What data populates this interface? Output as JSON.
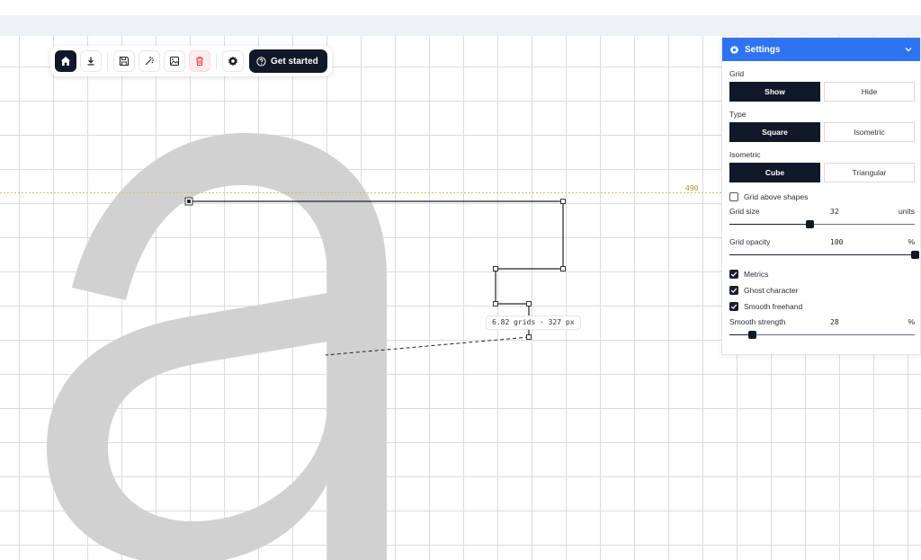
{
  "toolbar": {
    "buttons": [
      {
        "name": "home",
        "icon": "home-icon",
        "active": true
      },
      {
        "name": "download",
        "icon": "download-icon"
      },
      {
        "name": "save",
        "icon": "save-icon"
      },
      {
        "name": "wand",
        "icon": "magic-wand-icon"
      },
      {
        "name": "image",
        "icon": "image-icon"
      },
      {
        "name": "delete",
        "icon": "trash-icon"
      },
      {
        "name": "settings",
        "icon": "gear-icon"
      }
    ],
    "get_started_label": "Get started"
  },
  "canvas": {
    "ghost_character": "a",
    "metric_value": "490",
    "measure_label": "6.82 grids · 327 px"
  },
  "settings": {
    "title": "Settings",
    "grid": {
      "label": "Grid",
      "options": [
        "Show",
        "Hide"
      ],
      "selected": "Show"
    },
    "type": {
      "label": "Type",
      "options": [
        "Square",
        "Isometric"
      ],
      "selected": "Square"
    },
    "isometric": {
      "label": "Isometric",
      "options": [
        "Cube",
        "Triangular"
      ],
      "selected": "Cube"
    },
    "grid_above_shapes": {
      "label": "Grid above shapes",
      "checked": false
    },
    "grid_size": {
      "label": "Grid size",
      "value": "32",
      "unit": "units",
      "fraction": 0.43
    },
    "grid_opacity": {
      "label": "Grid opacity",
      "value": "100",
      "unit": "%",
      "fraction": 1.0
    },
    "metrics": {
      "label": "Metrics",
      "checked": true
    },
    "ghost_character": {
      "label": "Ghost character",
      "checked": true
    },
    "smooth_freehand": {
      "label": "Smooth freehand",
      "checked": true
    },
    "smooth_strength": {
      "label": "Smooth strength",
      "value": "28",
      "unit": "%",
      "fraction": 0.12
    }
  },
  "colors": {
    "accent": "#2f73f0",
    "dark": "#111827",
    "danger": "#e53e3e"
  }
}
